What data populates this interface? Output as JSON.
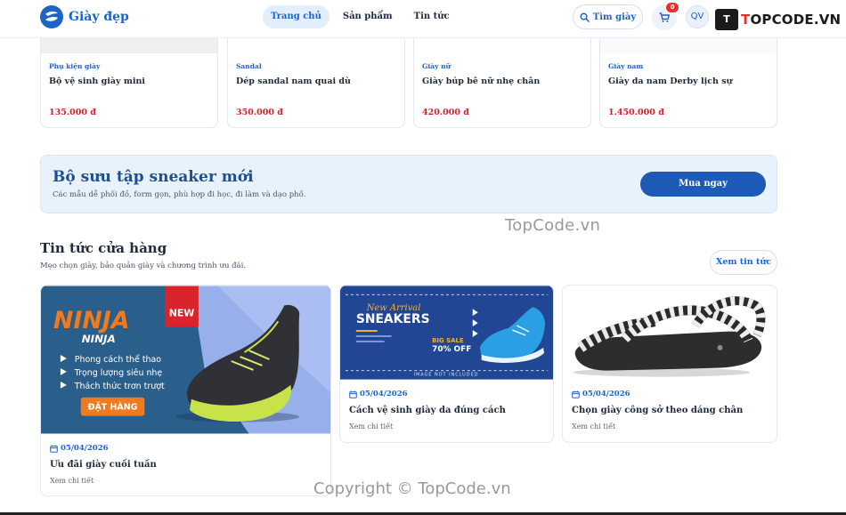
{
  "header": {
    "brand": "Giày đẹp",
    "nav": [
      "Trang chủ",
      "Sản phẩm",
      "Tin tức"
    ],
    "search_label": "Tìm giày",
    "cart_count": "0",
    "avatar_initials": "QV",
    "watermark_logo_mark": "T",
    "watermark_logo_text_1": "T",
    "watermark_logo_text_2": "OPCODE.VN"
  },
  "products": [
    {
      "category": "Phụ kiện giày",
      "name": "Bộ vệ sinh giày mini",
      "price": "135.000 đ"
    },
    {
      "category": "Sandal",
      "name": "Dép sandal nam quai dù",
      "price": "350.000 đ"
    },
    {
      "category": "Giày nữ",
      "name": "Giày búp bê nữ nhẹ chân",
      "price": "420.000 đ"
    },
    {
      "category": "Giày nam",
      "name": "Giày da nam Derby lịch sự",
      "price": "1.450.000 đ"
    }
  ],
  "promo": {
    "title": "Bộ sưu tập sneaker mới",
    "subtitle": "Các mẫu dễ phối đồ, form gọn, phù hợp đi học, đi làm và dạo phố.",
    "button": "Mua ngay"
  },
  "news": {
    "title": "Tin tức cửa hàng",
    "subtitle": "Mẹo chọn giày, bảo quản giày và chương trình ưu đãi.",
    "more_button": "Xem tin tức",
    "items": [
      {
        "date": "05/04/2026",
        "title": "Ưu đãi giày cuối tuần",
        "more": "Xem chi tiết",
        "image_text": {
          "brand": "NINJA",
          "sub": "NINJA",
          "badge": "NEW",
          "features": [
            "Phong cách thể thao",
            "Trọng lượng siêu nhẹ",
            "Thách thức trơn trượt"
          ],
          "cta": "ĐẶT HÀNG"
        }
      },
      {
        "date": "05/04/2026",
        "title": "Cách vệ sinh giày da đúng cách",
        "more": "Xem chi tiết",
        "image_text": {
          "script": "New Arrival",
          "headline": "SNEAKERS",
          "sale": "BIG SALE",
          "off": "70% OFF",
          "note": "IMAGE NOT INCLUDED"
        }
      },
      {
        "date": "05/04/2026",
        "title": "Chọn giày công sở theo dáng chân",
        "more": "Xem chi tiết"
      }
    ]
  },
  "watermarks": {
    "middle": "TopCode.vn",
    "bottom": "Copyright © TopCode.vn"
  },
  "colors": {
    "primary": "#1e63c6",
    "price": "#c8262c",
    "promo_bg": "#e8f2fd",
    "ninja_bg": "#2a5f8c",
    "ninja_orange": "#f07a1e",
    "sneaker_bg": "#1d3f86"
  }
}
